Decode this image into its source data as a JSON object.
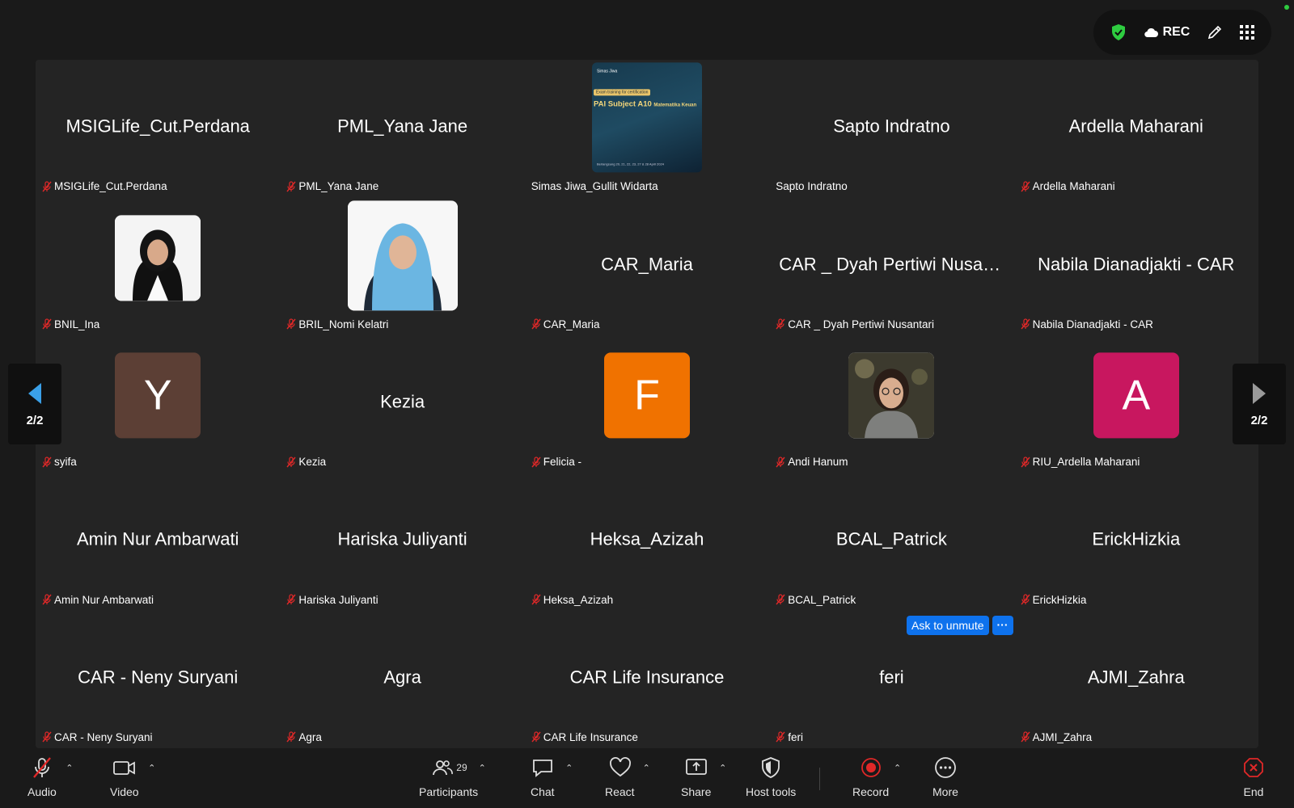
{
  "status": {
    "rec_label": "REC"
  },
  "pager": {
    "left": "2/2",
    "right": "2/2"
  },
  "tiles": [
    {
      "big": "MSIGLife_Cut.Perdana",
      "label": "MSIGLife_Cut.Perdana",
      "muted": true
    },
    {
      "big": "PML_Yana Jane",
      "label": "PML_Yana Jane",
      "muted": true
    },
    {
      "big": "",
      "label": "Simas Jiwa_Gullit Widarta",
      "muted": false,
      "share": {
        "brand": "Simas Jiwa",
        "title": "PAI Subject A10",
        "subtitle": "Matematika Keuan",
        "badge": "Exam training for certification",
        "footer": "Berlangsung 20, 21, 22, 23, 27 & 28 April 2024"
      }
    },
    {
      "big": "Sapto Indratno",
      "label": "Sapto Indratno",
      "muted": false
    },
    {
      "big": "Ardella Maharani",
      "label": "Ardella Maharani",
      "muted": true
    },
    {
      "big": "",
      "label": "BNIL_Ina",
      "muted": true
    },
    {
      "big": "",
      "label": "BRIL_Nomi Kelatri",
      "muted": true
    },
    {
      "big": "CAR_Maria",
      "label": "CAR_Maria",
      "muted": true
    },
    {
      "big": "CAR _ Dyah Pertiwi Nusan...",
      "label": "CAR _ Dyah Pertiwi Nusantari",
      "muted": true
    },
    {
      "big": "Nabila Dianadjakti - CAR",
      "label": "Nabila Dianadjakti - CAR",
      "muted": true
    },
    {
      "big": "",
      "label": "syifa",
      "muted": true,
      "letter": "Y"
    },
    {
      "big": "Kezia",
      "label": "Kezia",
      "muted": true
    },
    {
      "big": "",
      "label": "Felicia -",
      "muted": true,
      "letter": "F"
    },
    {
      "big": "",
      "label": "Andi Hanum",
      "muted": true
    },
    {
      "big": "",
      "label": "RIU_Ardella Maharani",
      "muted": true,
      "letter": "A"
    },
    {
      "big": "Amin Nur Ambarwati",
      "label": "Amin Nur Ambarwati",
      "muted": true
    },
    {
      "big": "Hariska Juliyanti",
      "label": "Hariska Juliyanti",
      "muted": true
    },
    {
      "big": "Heksa_Azizah",
      "label": "Heksa_Azizah",
      "muted": true
    },
    {
      "big": "BCAL_Patrick",
      "label": "BCAL_Patrick",
      "muted": true
    },
    {
      "big": "ErickHizkia",
      "label": "ErickHizkia",
      "muted": true
    },
    {
      "big": "CAR - Neny Suryani",
      "label": "CAR - Neny Suryani",
      "muted": true
    },
    {
      "big": "Agra",
      "label": "Agra",
      "muted": true
    },
    {
      "big": "CAR Life Insurance",
      "label": "CAR Life Insurance",
      "muted": true
    },
    {
      "big": "feri",
      "label": "feri",
      "muted": true
    },
    {
      "big": "AJMI_Zahra",
      "label": "AJMI_Zahra",
      "muted": true
    }
  ],
  "colors": {
    "letter_Y": "#5c3f35",
    "letter_F": "#f07200",
    "letter_A": "#c8175f",
    "muted_red": "#e02828",
    "accent_blue": "#0e72ed"
  },
  "hover_actions": {
    "ask_unmute": "Ask to unmute",
    "more": "···"
  },
  "toolbar": {
    "audio": "Audio",
    "video": "Video",
    "participants": "Participants",
    "participants_count": "29",
    "chat": "Chat",
    "react": "React",
    "share": "Share",
    "host_tools": "Host tools",
    "record": "Record",
    "more": "More",
    "end": "End"
  }
}
